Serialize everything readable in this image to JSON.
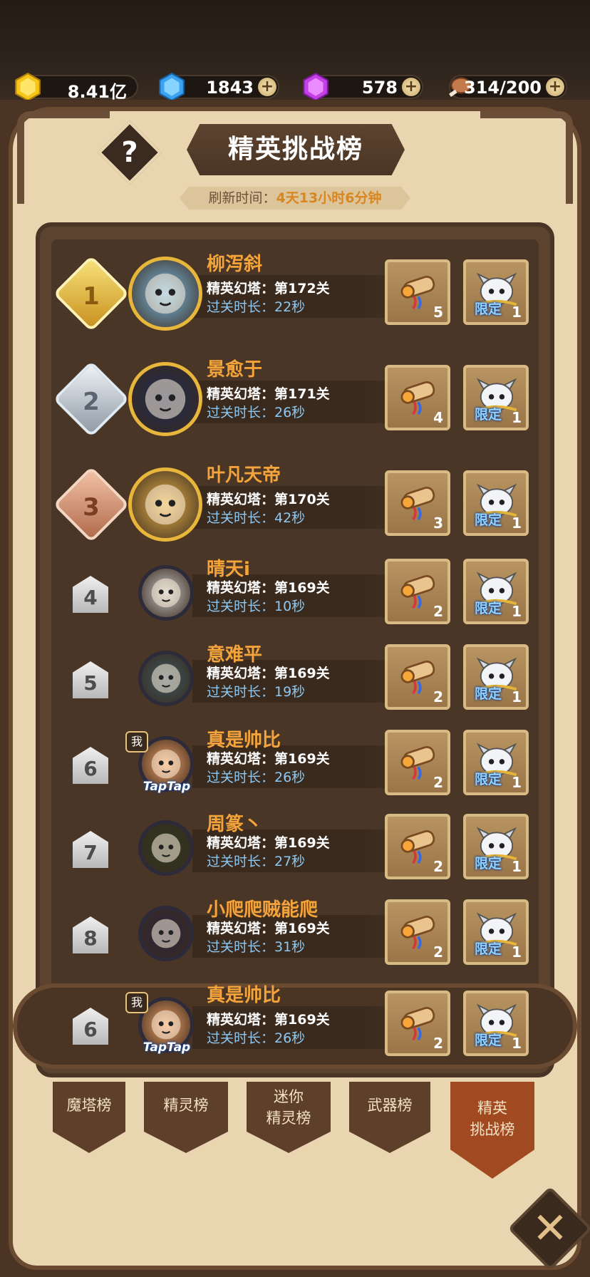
{
  "resources": {
    "gold": "8.41亿",
    "blue_gem": "1843",
    "purple_gem": "578",
    "meat": "314/200",
    "plus": "+"
  },
  "header": {
    "help": "?",
    "title": "精英挑战榜",
    "refresh_label": "刷新时间：",
    "refresh_time": "4天13小时6分钟"
  },
  "rows": [
    {
      "rank": "1",
      "name": "柳泻斜",
      "tower": "精英幻塔：第172关",
      "clear": "过关时长：22秒",
      "reward1": "5",
      "reward2": "1",
      "limited": "限定"
    },
    {
      "rank": "2",
      "name": "景愈于",
      "tower": "精英幻塔：第171关",
      "clear": "过关时长：26秒",
      "reward1": "4",
      "reward2": "1",
      "limited": "限定"
    },
    {
      "rank": "3",
      "name": "叶凡天帝",
      "tower": "精英幻塔：第170关",
      "clear": "过关时长：42秒",
      "reward1": "3",
      "reward2": "1",
      "limited": "限定"
    },
    {
      "rank": "4",
      "name": "晴天i",
      "tower": "精英幻塔：第169关",
      "clear": "过关时长：10秒",
      "reward1": "2",
      "reward2": "1",
      "limited": "限定"
    },
    {
      "rank": "5",
      "name": "意难平",
      "tower": "精英幻塔：第169关",
      "clear": "过关时长：19秒",
      "reward1": "2",
      "reward2": "1",
      "limited": "限定"
    },
    {
      "rank": "6",
      "name": "真是帅比",
      "tower": "精英幻塔：第169关",
      "clear": "过关时长：26秒",
      "reward1": "2",
      "reward2": "1",
      "limited": "限定",
      "me": "我",
      "brand": "TapTap"
    },
    {
      "rank": "7",
      "name": "周篆丶",
      "tower": "精英幻塔：第169关",
      "clear": "过关时长：27秒",
      "reward1": "2",
      "reward2": "1",
      "limited": "限定"
    },
    {
      "rank": "8",
      "name": "小爬爬贼能爬",
      "tower": "精英幻塔：第169关",
      "clear": "过关时长：31秒",
      "reward1": "2",
      "reward2": "1",
      "limited": "限定"
    }
  ],
  "my_row": {
    "rank": "6",
    "name": "真是帅比",
    "tower": "精英幻塔：第169关",
    "clear": "过关时长：26秒",
    "reward1": "2",
    "reward2": "1",
    "limited": "限定",
    "me": "我",
    "brand": "TapTap"
  },
  "tabs": [
    {
      "label": "魔塔榜"
    },
    {
      "label": "精灵榜"
    },
    {
      "label": "迷你\n精灵榜"
    },
    {
      "label": "武器榜"
    },
    {
      "label": "精英\n挑战榜",
      "active": true
    }
  ],
  "close": "✕",
  "colors": {
    "name": "#f4a43a",
    "clear_time": "#8cc8f2",
    "active_tab": "#a14a22",
    "tab": "#5e3f2a"
  }
}
